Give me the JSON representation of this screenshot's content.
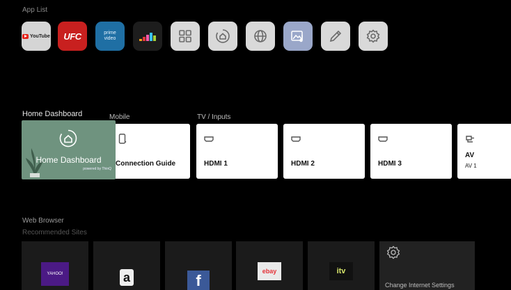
{
  "app_list": {
    "label": "App List",
    "apps": [
      {
        "name": "YouTube",
        "label": "YouTube"
      },
      {
        "name": "UFC",
        "label": "UFC"
      },
      {
        "name": "prime video",
        "label": "prime video"
      },
      {
        "name": "Deezer",
        "label": ""
      },
      {
        "name": "Apps",
        "icon": "grid-icon"
      },
      {
        "name": "Home Dashboard",
        "icon": "home-dashboard-icon"
      },
      {
        "name": "Web Browser",
        "icon": "globe-icon"
      },
      {
        "name": "Gallery",
        "icon": "photo-music-icon"
      },
      {
        "name": "Edit",
        "icon": "pencil-icon"
      },
      {
        "name": "Settings",
        "icon": "gear-icon"
      }
    ]
  },
  "home_dashboard": {
    "section_label": "Home Dashboard",
    "title": "Home Dashboard",
    "powered_by": "powered by ThinQ"
  },
  "mobile": {
    "section_label": "Mobile",
    "card_title": "Connection Guide"
  },
  "tv_inputs": {
    "section_label": "TV / Inputs",
    "inputs": [
      {
        "title": "HDMI 1"
      },
      {
        "title": "HDMI 2"
      },
      {
        "title": "HDMI 3"
      },
      {
        "title": "AV",
        "sub": "AV 1"
      }
    ]
  },
  "web_browser": {
    "section_label": "Web Browser",
    "sub_label": "Recommended Sites",
    "sites": [
      {
        "name": "yahoo",
        "label": "YAHOO!"
      },
      {
        "name": "amazon",
        "label": "a"
      },
      {
        "name": "facebook",
        "label": "f"
      },
      {
        "name": "ebay",
        "label": "ebay"
      },
      {
        "name": "itv",
        "label": "itv"
      }
    ],
    "settings_label": "Change Internet Settings"
  },
  "colors": {
    "background": "#000000",
    "card": "#ffffff",
    "home_dashboard": "#6f937f",
    "ufc": "#c8201f",
    "prime": "#1f6fa4"
  }
}
